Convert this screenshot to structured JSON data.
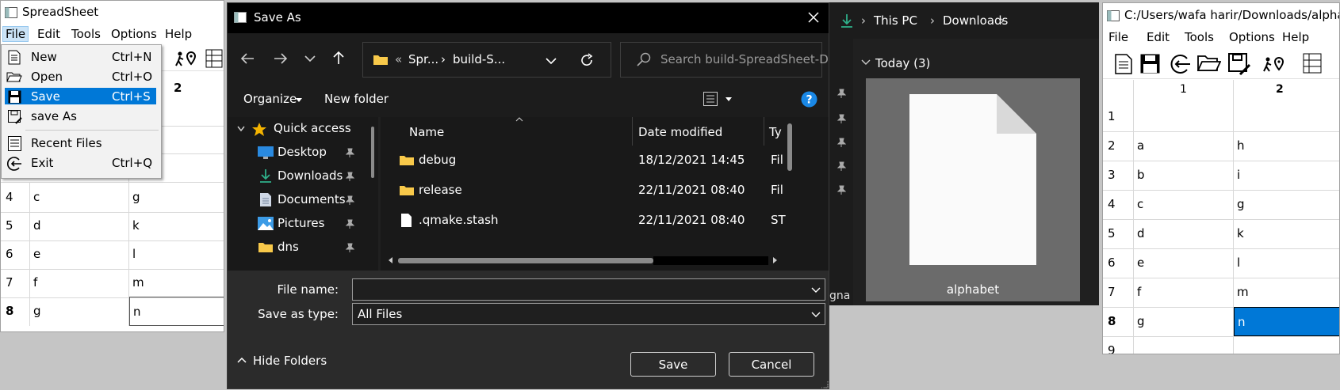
{
  "left_window": {
    "title": "SpreadSheet",
    "menu": [
      "File",
      "Edit",
      "Tools",
      "Options",
      "Help"
    ],
    "col_header_2": "2",
    "rows": [
      {
        "num": "4",
        "c1": "c",
        "c2": "g"
      },
      {
        "num": "5",
        "c1": "d",
        "c2": "k"
      },
      {
        "num": "6",
        "c1": "e",
        "c2": "l"
      },
      {
        "num": "7",
        "c1": "f",
        "c2": "m"
      },
      {
        "num": "8",
        "c1": "g",
        "c2": "n"
      }
    ]
  },
  "file_menu": {
    "items": [
      {
        "label": "New",
        "shortcut": "Ctrl+N",
        "icon": "new-file-icon"
      },
      {
        "label": "Open",
        "shortcut": "Ctrl+O",
        "icon": "open-folder-icon"
      },
      {
        "label": "Save",
        "shortcut": "Ctrl+S",
        "icon": "save-icon",
        "selected": true
      },
      {
        "label": "save As",
        "shortcut": "",
        "icon": "save-as-icon"
      },
      {
        "label": "Recent Files",
        "shortcut": "",
        "icon": "recent-files-icon"
      },
      {
        "label": "Exit",
        "shortcut": "Ctrl+Q",
        "icon": "exit-icon"
      }
    ]
  },
  "save_dialog": {
    "title": "Save As",
    "address": {
      "prefix": "«",
      "part1": "Spr...",
      "sep": "›",
      "part2": "build-S..."
    },
    "search_placeholder": "Search build-SpreadSheet-D...",
    "organize_label": "Organize",
    "new_folder_label": "New folder",
    "nav": {
      "quick_access": "Quick access",
      "items": [
        "Desktop",
        "Downloads",
        "Documents",
        "Pictures",
        "dns"
      ]
    },
    "columns": {
      "name": "Name",
      "date": "Date modified",
      "type": "Ty"
    },
    "files": [
      {
        "name": "debug",
        "date": "18/12/2021 14:45",
        "type": "Fil",
        "kind": "folder"
      },
      {
        "name": "release",
        "date": "22/11/2021 08:40",
        "type": "Fil",
        "kind": "folder"
      },
      {
        "name": ".qmake.stash",
        "date": "22/11/2021 08:40",
        "type": "ST",
        "kind": "file"
      }
    ],
    "file_name_label": "File name:",
    "file_name_value": "",
    "save_type_label": "Save as type:",
    "save_type_value": "All Files",
    "hide_folders_label": "Hide Folders",
    "save_button": "Save",
    "cancel_button": "Cancel"
  },
  "explorer": {
    "breadcrumb": [
      "This PC",
      "Downloads"
    ],
    "group_label": "Today (3)",
    "thumb_label": "alphabet",
    "clipped_label": "gna"
  },
  "right_window": {
    "title": "C:/Users/wafa harir/Downloads/alphabet",
    "menu": [
      "File",
      "Edit",
      "Tools",
      "Options",
      "Help"
    ],
    "col_headers": [
      "1",
      "2"
    ],
    "rows": [
      {
        "num": "1",
        "c1": "",
        "c2": ""
      },
      {
        "num": "2",
        "c1": "a",
        "c2": "h"
      },
      {
        "num": "3",
        "c1": "b",
        "c2": "i"
      },
      {
        "num": "4",
        "c1": "c",
        "c2": "g"
      },
      {
        "num": "5",
        "c1": "d",
        "c2": "k"
      },
      {
        "num": "6",
        "c1": "e",
        "c2": "l"
      },
      {
        "num": "7",
        "c1": "f",
        "c2": "m"
      },
      {
        "num": "8",
        "c1": "g",
        "c2": "n"
      },
      {
        "num": "9",
        "c1": "",
        "c2": ""
      }
    ]
  },
  "colors": {
    "accent": "#0078d7",
    "dialog_bg": "#202020",
    "thumb_bg": "#6b6b6b"
  }
}
